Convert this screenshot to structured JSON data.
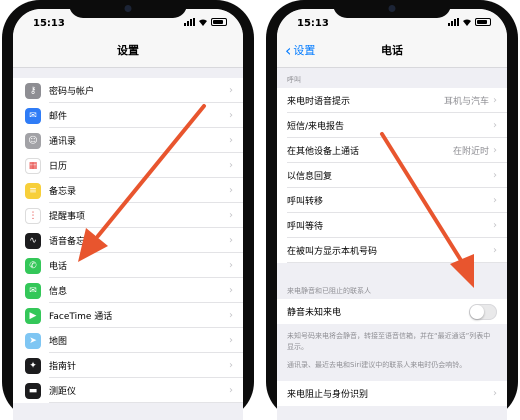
{
  "left_phone": {
    "status_time": "15:13",
    "nav_title": "设置",
    "rows": [
      {
        "label": "密码与帐户",
        "icon": "key-icon",
        "color": "#8e8e93",
        "glyph": "⚷"
      },
      {
        "label": "邮件",
        "icon": "mail-icon",
        "color": "#2f7cf6",
        "glyph": "✉"
      },
      {
        "label": "通讯录",
        "icon": "contacts-icon",
        "color": "#a2a2a6",
        "glyph": "☺"
      },
      {
        "label": "日历",
        "icon": "calendar-icon",
        "color": "#ffffff",
        "glyph": "▦"
      },
      {
        "label": "备忘录",
        "icon": "notes-icon",
        "color": "#f7cf3a",
        "glyph": "≡"
      },
      {
        "label": "提醒事项",
        "icon": "reminders-icon",
        "color": "#ffffff",
        "glyph": "⋮"
      },
      {
        "label": "语音备忘录",
        "icon": "voice-memos-icon",
        "color": "#1c1c1e",
        "glyph": "∿"
      },
      {
        "label": "电话",
        "icon": "phone-icon",
        "color": "#34c759",
        "glyph": "✆"
      },
      {
        "label": "信息",
        "icon": "messages-icon",
        "color": "#34c759",
        "glyph": "✉"
      },
      {
        "label": "FaceTime 通话",
        "icon": "facetime-icon",
        "color": "#34c759",
        "glyph": "▶"
      },
      {
        "label": "地图",
        "icon": "maps-icon",
        "color": "#7fc6f3",
        "glyph": "➤"
      },
      {
        "label": "指南针",
        "icon": "compass-icon",
        "color": "#1c1c1e",
        "glyph": "✦"
      },
      {
        "label": "测距仪",
        "icon": "measure-icon",
        "color": "#1c1c1e",
        "glyph": "▬"
      }
    ]
  },
  "right_phone": {
    "status_time": "15:13",
    "back_label": "设置",
    "nav_title": "电话",
    "section_calls": "呼叫",
    "rows_calls": [
      {
        "label": "来电时语音提示",
        "value": "耳机与汽车"
      },
      {
        "label": "短信/来电报告",
        "value": ""
      },
      {
        "label": "在其他设备上通话",
        "value": "在附近时"
      },
      {
        "label": "以信息回复",
        "value": ""
      },
      {
        "label": "呼叫转移",
        "value": ""
      },
      {
        "label": "呼叫等待",
        "value": ""
      },
      {
        "label": "在被叫方显示本机号码",
        "value": ""
      }
    ],
    "section_silence": "来电静音和已阻止的联系人",
    "silence_label": "静音未知来电",
    "footnote_1": "未知号码来电将会静音，转接至语音信箱，并在“最近通话”列表中显示。",
    "footnote_2": "通讯录、最近去电和Siri建议中的联系人来电时仍会响铃。",
    "blocking_label": "来电阻止与身份识别"
  },
  "colors": {
    "accent": "#007aff",
    "arrow": "#e8552e"
  }
}
